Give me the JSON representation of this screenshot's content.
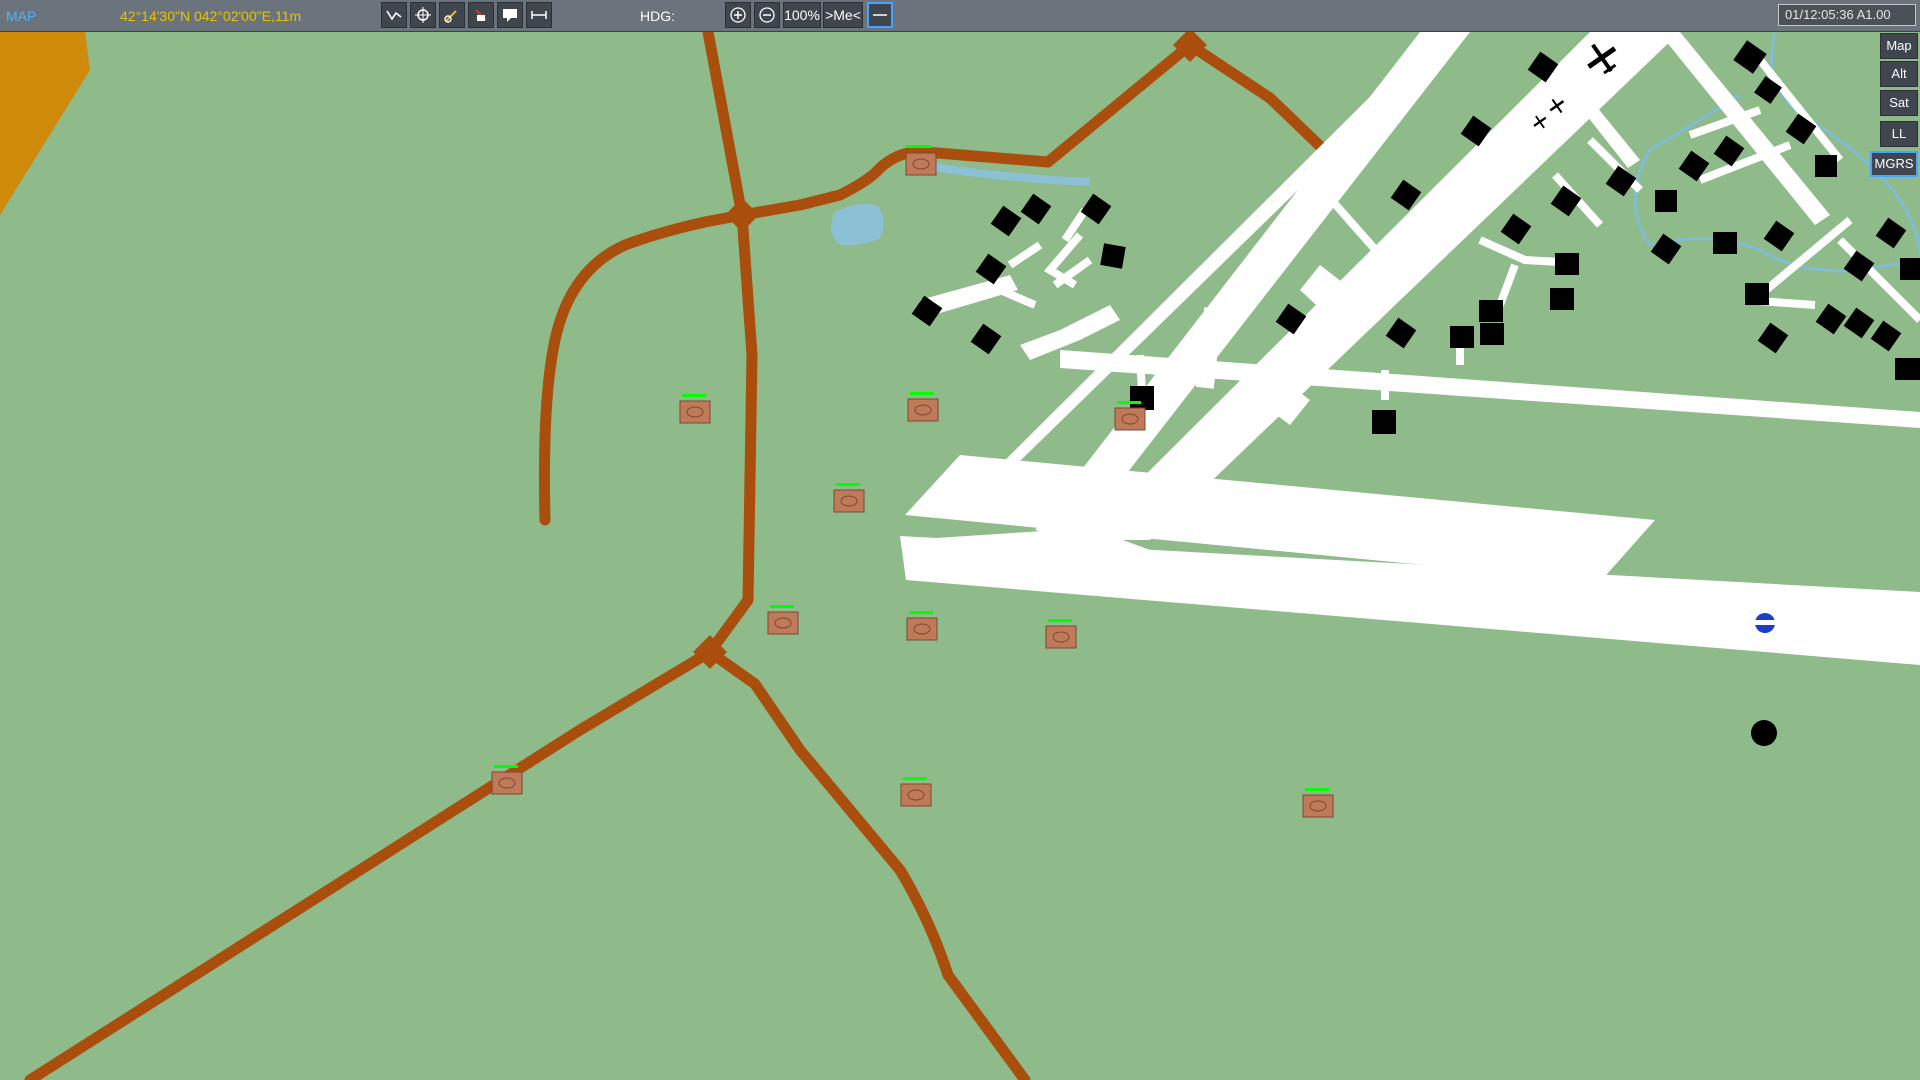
{
  "toolbar": {
    "title": "MAP",
    "coordinates": "42°14'30\"N 042°02'00\"E,11m",
    "hdg_label": "HDG:",
    "zoom_level": "100%",
    "me_label": ">Me<",
    "datetime": "01/12:05:36 A1.00"
  },
  "layers": {
    "map": "Map",
    "alt": "Alt",
    "sat": "Sat",
    "ll": "LL",
    "mgrs": "MGRS"
  },
  "colors": {
    "terrain": "#8fba8a",
    "road": "#a94e0d",
    "runway": "#ffffff",
    "building": "#000000",
    "unit_fill": "#c07a5a",
    "unit_health": "#00ff00",
    "title": "#4fb3f0",
    "coordinates": "#e8c200"
  },
  "icons": [
    "route-tool-icon",
    "unit-tool-icon",
    "sam-tool-icon",
    "delete-tool-icon",
    "message-tool-icon",
    "ruler-tool-icon",
    "zoom-in-icon",
    "zoom-out-icon",
    "scale-icon"
  ]
}
